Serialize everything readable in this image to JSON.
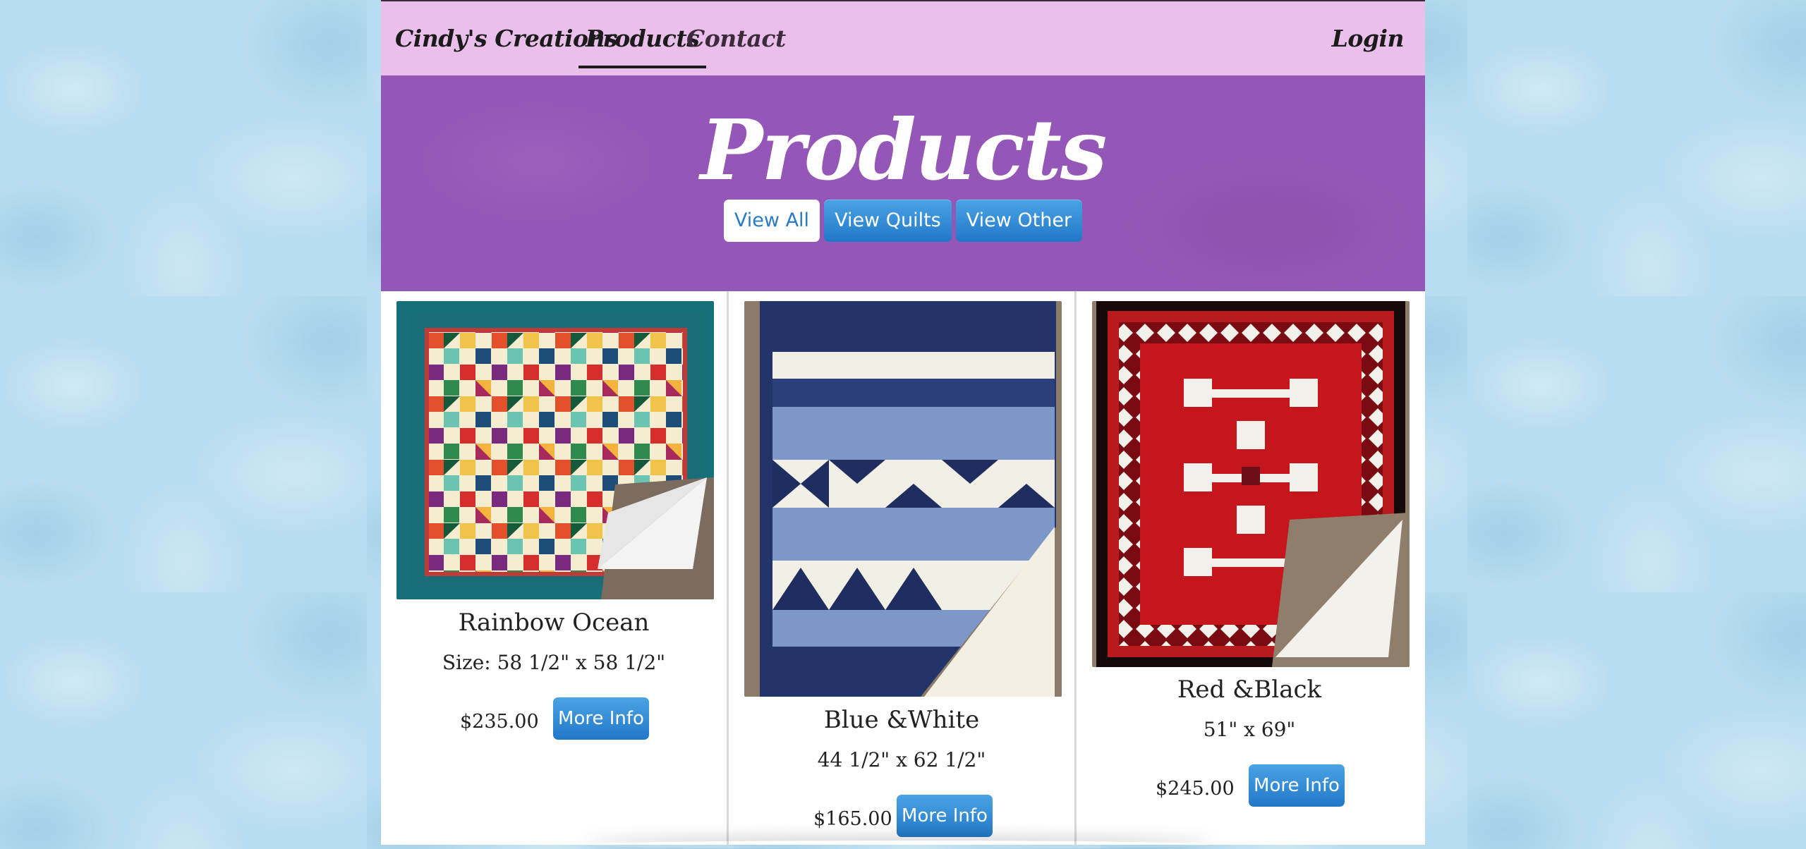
{
  "nav": {
    "brand": "Cindy's Creations",
    "products": "Products",
    "contact": "Contact",
    "login": "Login"
  },
  "hero": {
    "title": "Products",
    "filters": [
      {
        "label": "View All",
        "active": true
      },
      {
        "label": "View Quilts",
        "active": false
      },
      {
        "label": "View Other",
        "active": false
      }
    ]
  },
  "products": [
    {
      "name": "Rainbow Ocean",
      "size": "Size: 58 1/2\" x 58 1/2\"",
      "price": "$235.00",
      "button": "More Info"
    },
    {
      "name": "Blue &White",
      "size": "44 1/2\" x 62 1/2\"",
      "price": "$165.00",
      "button": "More Info"
    },
    {
      "name": "Red &Black",
      "size": "51\" x 69\"",
      "price": "$245.00",
      "button": "More Info"
    }
  ],
  "colors": {
    "nav_bg": "#ebbfeb",
    "hero_bg": "#9457b7",
    "button_blue": "#2f8bd6",
    "page_bg": "#b9ddf0"
  }
}
